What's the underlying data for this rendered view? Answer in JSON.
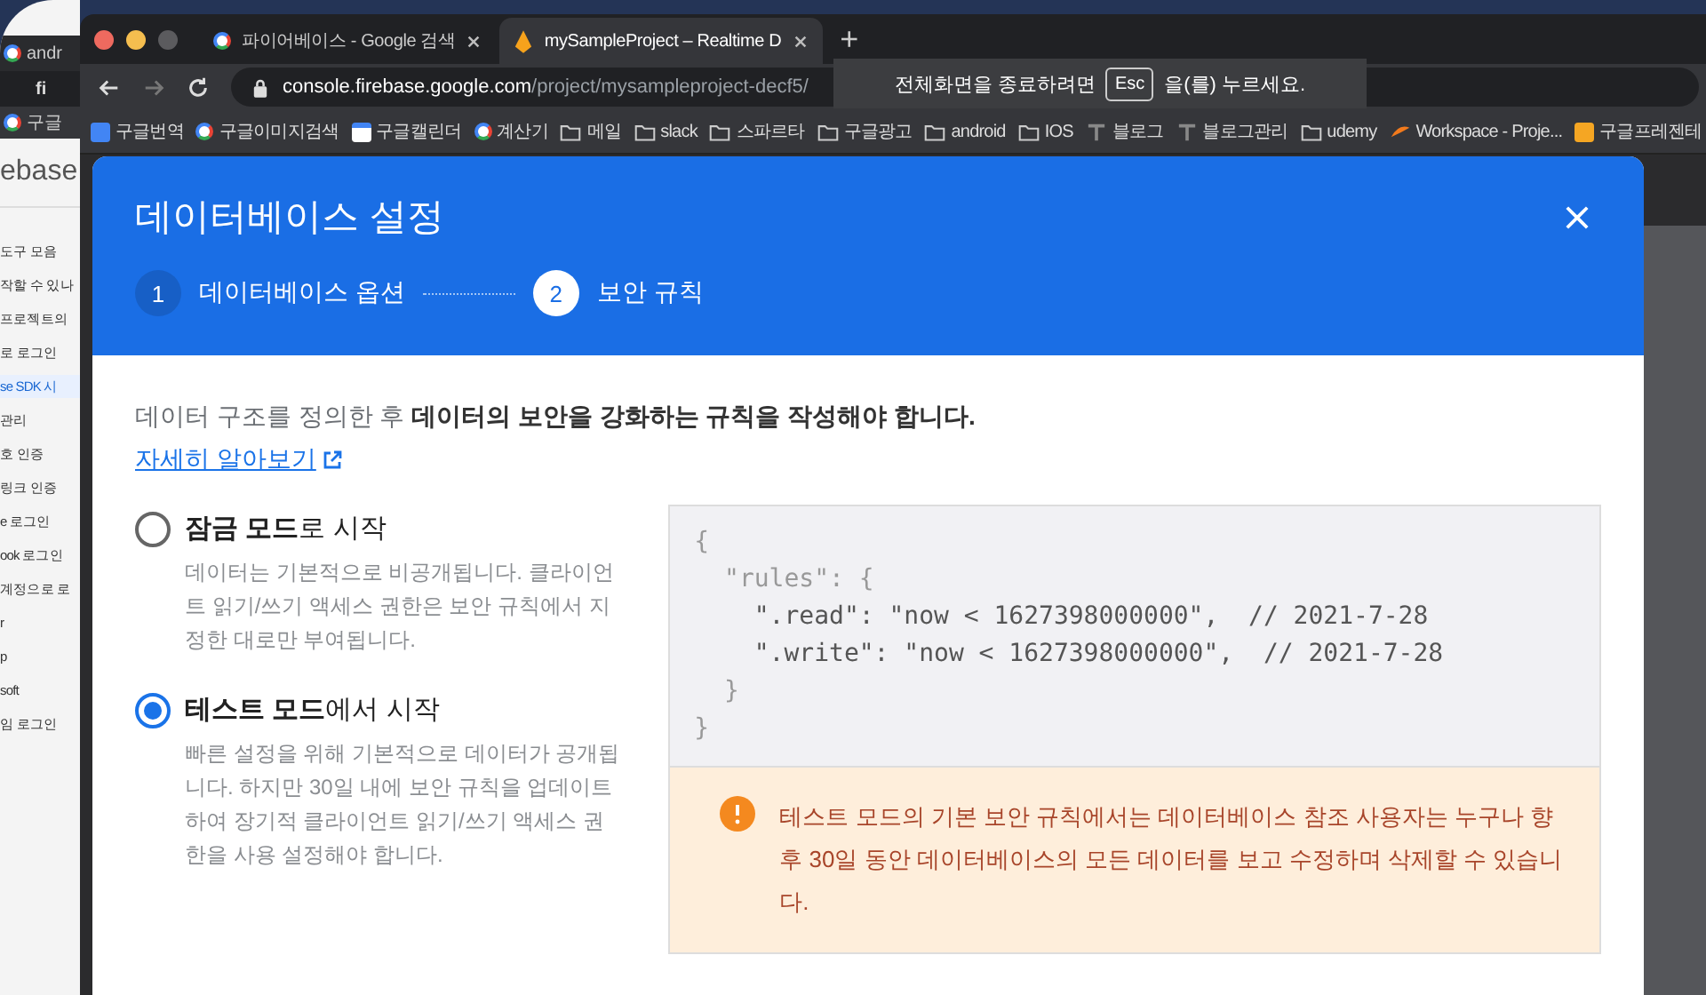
{
  "back_window": {
    "tab": "andr",
    "url": "fi",
    "bookmark": "구글",
    "logo": "ebase",
    "items": [
      {
        "label": "도구 모음",
        "selected": false
      },
      {
        "label": "작할 수 있나",
        "selected": false
      },
      {
        "label": "프로젝트의",
        "selected": false
      },
      {
        "label": "로 로그인",
        "selected": false
      },
      {
        "label": "se SDK 시",
        "selected": true
      },
      {
        "label": "관리",
        "selected": false
      },
      {
        "label": "호 인증",
        "selected": false
      },
      {
        "label": "링크 인증",
        "selected": false
      },
      {
        "label": "e 로그인",
        "selected": false
      },
      {
        "label": "ook 로그인",
        "selected": false
      },
      {
        "label": "계정으로 로",
        "selected": false
      },
      {
        "label": "r",
        "selected": false
      },
      {
        "label": "p",
        "selected": false
      },
      {
        "label": "soft",
        "selected": false
      },
      {
        "label": "임 로그인",
        "selected": false
      }
    ]
  },
  "tabs": [
    {
      "title": "파이어베이스 - Google 검색",
      "selected": false
    },
    {
      "title": "mySampleProject – Realtime D",
      "selected": true
    }
  ],
  "new_tab": "+",
  "address": {
    "host": "console.firebase.google.com",
    "path": "/project/mysampleproject-decf5/"
  },
  "fullscreen_notice": {
    "before": "전체화면을 종료하려면",
    "key": "Esc",
    "after": "을(를) 누르세요."
  },
  "bookmarks": [
    {
      "label": "구글번역"
    },
    {
      "label": "구글이미지검색"
    },
    {
      "label": "구글캘린더"
    },
    {
      "label": "계산기"
    },
    {
      "label": "메일"
    },
    {
      "label": "slack"
    },
    {
      "label": "스파르타"
    },
    {
      "label": "구글광고"
    },
    {
      "label": "android"
    },
    {
      "label": "IOS"
    },
    {
      "label": "블로그"
    },
    {
      "label": "블로그관리"
    },
    {
      "label": "udemy"
    },
    {
      "label": "Workspace - Proje..."
    },
    {
      "label": "구글프레젠테"
    }
  ],
  "dialog": {
    "title": "데이터베이스 설정",
    "steps": [
      {
        "number": "1",
        "label": "데이터베이스 옵션",
        "selected": false
      },
      {
        "number": "2",
        "label": "보안 규칙",
        "selected": true
      }
    ],
    "intro": "데이터 구조를 정의한 후 **데이터의 보안을 강화하는 규칙을 작성해야 합니다.**",
    "learn_more": "자세히 알아보기",
    "modes": [
      {
        "title": "**잠금 모드**로 시작",
        "description": "데이터는 기본적으로 비공개됩니다. 클라이언트 읽기/쓰기 액세스 권한은 보안 규칙에서 지정한 대로만 부여됩니다.",
        "selected": false
      },
      {
        "title": "**테스트 모드**에서 시작",
        "description": "빠른 설정을 위해 기본적으로 데이터가 공개됩니다. 하지만 30일 내에 보안 규칙을 업데이트하여 장기적 클라이언트 읽기/쓰기 액세스 권한을 사용 설정해야 합니다.",
        "selected": true
      }
    ],
    "code": [
      {
        "kind": "muted",
        "text": "{"
      },
      {
        "kind": "muted",
        "text": "  \"rules\": {"
      },
      {
        "kind": "strong",
        "text": "    \".read\": \"now < 1627398000000\",  // 2021-7-28"
      },
      {
        "kind": "strong",
        "text": "    \".write\": \"now < 1627398000000\",  // 2021-7-28"
      },
      {
        "kind": "muted",
        "text": "  }"
      },
      {
        "kind": "muted",
        "text": "}"
      }
    ],
    "warning": "테스트 모드의 기본 보안 규칙에서는 데이터베이스 참조 사용자는 누구나 향후 30일 동안 데이터베이스의 모든 데이터를 보고 수정하며 삭제할 수 있습니다."
  }
}
